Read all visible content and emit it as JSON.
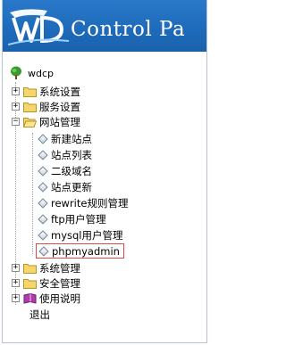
{
  "banner": {
    "title": "Control Pa",
    "brand_color": "#1e6bbb"
  },
  "tree": {
    "root_label": "wdcp",
    "root_icon": "tree-icon",
    "nodes": [
      {
        "label": "系统设置",
        "state": "collapsed",
        "toggle": "+"
      },
      {
        "label": "服务设置",
        "state": "collapsed",
        "toggle": "+"
      },
      {
        "label": "网站管理",
        "state": "expanded",
        "toggle": "−",
        "children": [
          {
            "label": "新建站点"
          },
          {
            "label": "站点列表"
          },
          {
            "label": "二级域名"
          },
          {
            "label": "站点更新"
          },
          {
            "label": "rewrite规则管理"
          },
          {
            "label": "ftp用户管理"
          },
          {
            "label": "mysql用户管理"
          },
          {
            "label": "phpmyadmin",
            "highlighted": true
          }
        ]
      },
      {
        "label": "系统管理",
        "state": "collapsed",
        "toggle": "+"
      },
      {
        "label": "安全管理",
        "state": "collapsed",
        "toggle": "+"
      },
      {
        "label": "使用说明",
        "state": "collapsed",
        "toggle": "+",
        "icon": "book-icon"
      }
    ],
    "logout_label": "退出"
  }
}
